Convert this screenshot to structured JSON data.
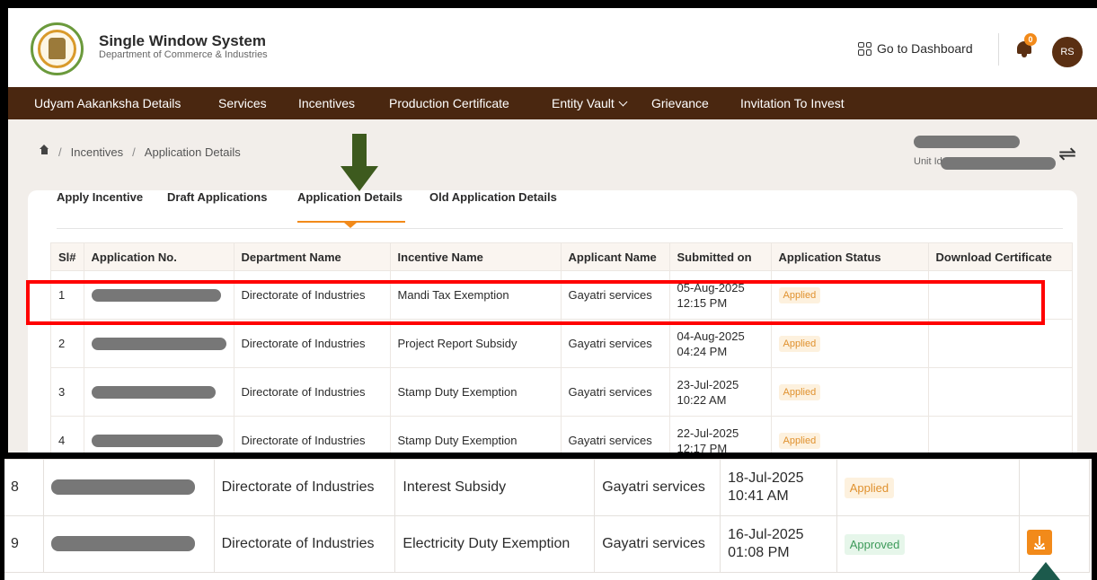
{
  "header": {
    "title": "Single Window System",
    "subtitle": "Department of Commerce & Industries",
    "dashboard_link": "Go to Dashboard",
    "notification_count": "0",
    "avatar_initials": "RS"
  },
  "nav": {
    "items": [
      "Udyam Aakanksha Details",
      "Services",
      "Incentives",
      "Production Certificate",
      "Entity Vault",
      "Grievance",
      "Invitation To Invest"
    ]
  },
  "breadcrumb": {
    "items": [
      "Incentives",
      "Application Details"
    ]
  },
  "unit": {
    "label": "Unit Id:"
  },
  "tabs": [
    "Apply Incentive",
    "Draft Applications",
    "Application Details",
    "Old Application Details"
  ],
  "active_tab": "Application Details",
  "table": {
    "columns": [
      "Sl#",
      "Application No.",
      "Department Name",
      "Incentive Name",
      "Applicant Name",
      "Submitted on",
      "Application Status",
      "Download Certificate"
    ],
    "rows": [
      {
        "sl": "1",
        "department": "Directorate of Industries",
        "incentive": "Mandi Tax Exemption",
        "applicant": "Gayatri services",
        "date": "05-Aug-2025",
        "time": "12:15 PM",
        "status": "Applied"
      },
      {
        "sl": "2",
        "department": "Directorate of Industries",
        "incentive": "Project Report Subsidy",
        "applicant": "Gayatri services",
        "date": "04-Aug-2025",
        "time": "04:24 PM",
        "status": "Applied"
      },
      {
        "sl": "3",
        "department": "Directorate of Industries",
        "incentive": "Stamp Duty Exemption",
        "applicant": "Gayatri services",
        "date": "23-Jul-2025",
        "time": "10:22 AM",
        "status": "Applied"
      },
      {
        "sl": "4",
        "department": "Directorate of Industries",
        "incentive": "Stamp Duty Exemption",
        "applicant": "Gayatri services",
        "date": "22-Jul-2025",
        "time": "12:17 PM",
        "status": "Applied"
      }
    ]
  },
  "zoom_rows": [
    {
      "sl": "8",
      "department": "Directorate of Industries",
      "incentive": "Interest Subsidy",
      "applicant": "Gayatri services",
      "date": "18-Jul-2025",
      "time": "10:41 AM",
      "status": "Applied"
    },
    {
      "sl": "9",
      "department": "Directorate of Industries",
      "incentive": "Electricity Duty Exemption",
      "applicant": "Gayatri services",
      "date": "16-Jul-2025",
      "time": "01:08 PM",
      "status": "Approved"
    }
  ],
  "colors": {
    "nav_bg": "#4a2710",
    "accent": "#f28a1a",
    "highlight": "#ff0000",
    "arrow_green": "#3d5a1e",
    "arrow_teal": "#1c5a4c"
  }
}
